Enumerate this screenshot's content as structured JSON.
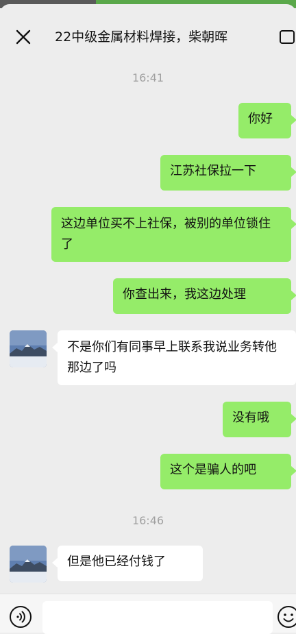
{
  "header": {
    "title": "22中级金属材料焊接，柴朝晖",
    "close_icon": "close-icon",
    "more_icon": "more-icon"
  },
  "timestamps": [
    "16:41",
    "16:46"
  ],
  "messages": [
    {
      "side": "out",
      "text": "你好"
    },
    {
      "side": "out",
      "text": "江苏社保拉一下"
    },
    {
      "side": "out",
      "text": "这边单位买不上社保，被别的单位锁住了"
    },
    {
      "side": "out",
      "text": "你查出来，我这边处理"
    },
    {
      "side": "in",
      "text": "不是你们有同事早上联系我说业务转他那边了吗"
    },
    {
      "side": "out",
      "text": "没有哦"
    },
    {
      "side": "out",
      "text": "这个是骗人的吧"
    },
    {
      "side": "in",
      "text": "但是他已经付钱了"
    }
  ],
  "input_bar": {
    "voice_icon": "voice-icon",
    "emoji_icon": "emoji-icon",
    "input_value": ""
  },
  "colors": {
    "background": "#ededed",
    "bubble_out": "#95ec69",
    "bubble_in": "#ffffff",
    "timestamp": "#a0a0a0"
  }
}
